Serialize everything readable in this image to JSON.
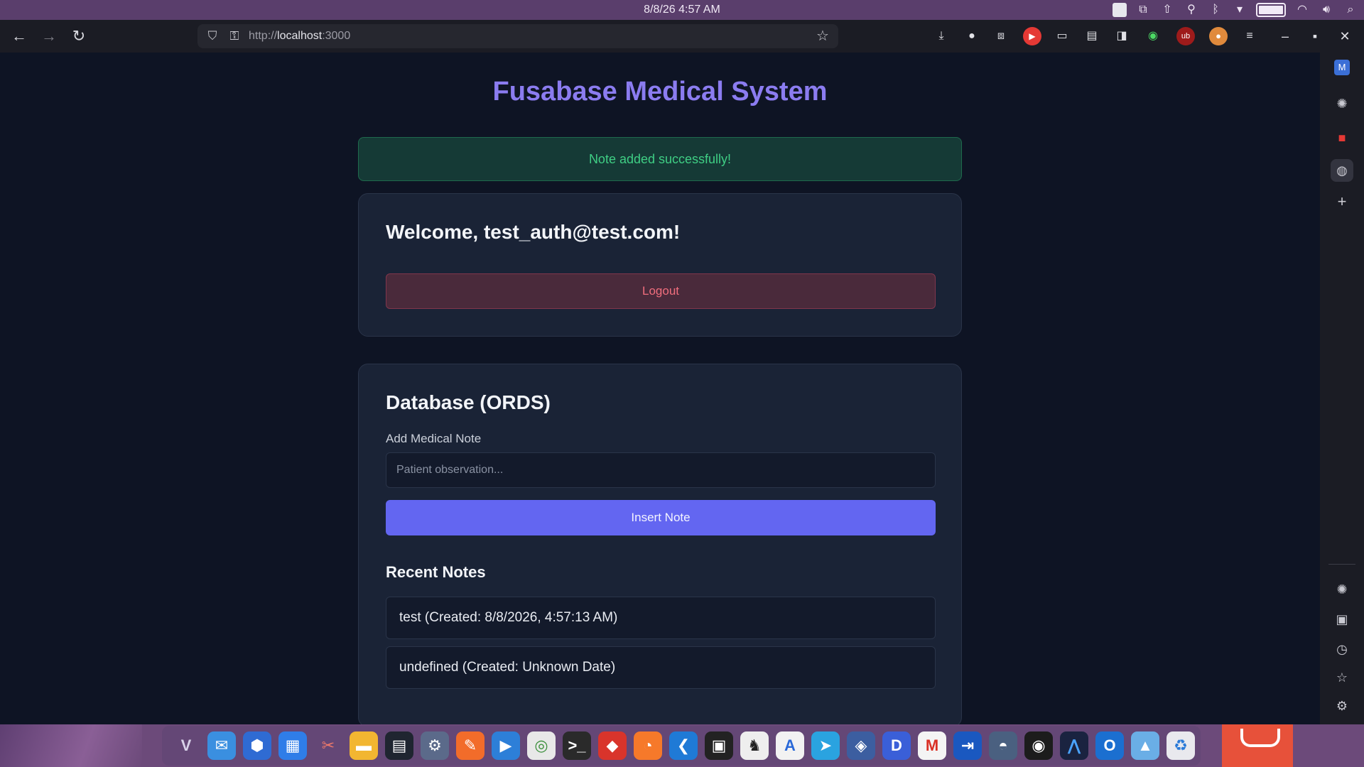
{
  "system": {
    "clock": "8/8/26   4:57 AM"
  },
  "browser": {
    "url": "http://localhost:3000",
    "url_host": "localhost",
    "url_prefix": "http://",
    "url_port": ":3000"
  },
  "app": {
    "title": "Fusabase Medical System",
    "alert": "Note added successfully!",
    "welcome": "Welcome, test_auth@test.com!",
    "logout_label": "Logout",
    "db_title": "Database (ORDS)",
    "add_note_label": "Add Medical Note",
    "note_placeholder": "Patient observation...",
    "note_value": "",
    "insert_label": "Insert Note",
    "recent_title": "Recent Notes",
    "notes": [
      "test (Created: 8/8/2026, 4:57:13 AM)",
      "undefined (Created: Unknown Date)"
    ]
  },
  "sidebar": {
    "items": [
      "mail-icon",
      "chatgpt-icon",
      "todo-icon",
      "globe-icon",
      "add-icon",
      "chatgpt-icon",
      "save-icon",
      "history-icon",
      "bookmarks-icon",
      "settings-icon"
    ]
  },
  "colors": {
    "accent": "#6366f1",
    "title": "#8b7cf0",
    "success": "#3fce84",
    "danger": "#f06e7d"
  }
}
